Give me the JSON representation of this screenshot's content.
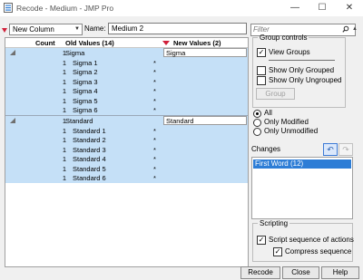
{
  "window": {
    "title": "Recode - Medium - JMP Pro",
    "minimize_glyph": "—",
    "maximize_glyph": "☐",
    "close_glyph": "✕"
  },
  "toolbar": {
    "new_column_option": "New Column",
    "dropdown_glyph": "▼",
    "name_label": "Name:",
    "name_value": "Medium 2"
  },
  "table": {
    "col_count": "Count",
    "col_old": "Old Values (14)",
    "col_new": "New Values (2)",
    "groups": [
      {
        "rows": [
          {
            "count": "1",
            "old": "Sigma",
            "new": "Sigma",
            "star": ""
          },
          {
            "count": "1",
            "old": "Sigma 1",
            "new": "",
            "star": "*"
          },
          {
            "count": "1",
            "old": "Sigma 2",
            "new": "",
            "star": "*"
          },
          {
            "count": "1",
            "old": "Sigma 3",
            "new": "",
            "star": "*"
          },
          {
            "count": "1",
            "old": "Sigma 4",
            "new": "",
            "star": "*"
          },
          {
            "count": "1",
            "old": "Sigma 5",
            "new": "",
            "star": "*"
          },
          {
            "count": "1",
            "old": "Sigma 6",
            "new": "",
            "star": "*"
          }
        ]
      },
      {
        "rows": [
          {
            "count": "1",
            "old": "Standard",
            "new": "Standard",
            "star": ""
          },
          {
            "count": "1",
            "old": "Standard 1",
            "new": "",
            "star": "*"
          },
          {
            "count": "1",
            "old": "Standard 2",
            "new": "",
            "star": "*"
          },
          {
            "count": "1",
            "old": "Standard 3",
            "new": "",
            "star": "*"
          },
          {
            "count": "1",
            "old": "Standard 4",
            "new": "",
            "star": "*"
          },
          {
            "count": "1",
            "old": "Standard 5",
            "new": "",
            "star": "*"
          },
          {
            "count": "1",
            "old": "Standard 6",
            "new": "",
            "star": "*"
          }
        ]
      }
    ]
  },
  "filter": {
    "placeholder": "Filter"
  },
  "group_controls": {
    "legend": "Group controls",
    "view_groups": {
      "label": "View Groups",
      "checked": true
    },
    "show_only_grouped": {
      "label": "Show Only Grouped",
      "checked": false
    },
    "show_only_ungrouped": {
      "label": "Show Only Ungrouped",
      "checked": false
    },
    "group_button": "Group"
  },
  "modified_filter": {
    "options": [
      "All",
      "Only Modified",
      "Only Unmodified"
    ],
    "selected": "All"
  },
  "changes": {
    "label": "Changes",
    "items": [
      "First Word (12)"
    ],
    "undo_glyph": "↶",
    "redo_glyph": "↷"
  },
  "scripting": {
    "legend": "Scripting",
    "script_sequence": {
      "label": "Script sequence of actions",
      "checked": true
    },
    "compress_sequence": {
      "label": "Compress sequence",
      "checked": true
    }
  },
  "buttons": {
    "recode": "Recode",
    "close": "Close",
    "help": "Help"
  },
  "colors": {
    "group_highlight": "#c5e0f7",
    "selection": "#2d7dd6",
    "new_values_arrow": "#d0203a"
  }
}
